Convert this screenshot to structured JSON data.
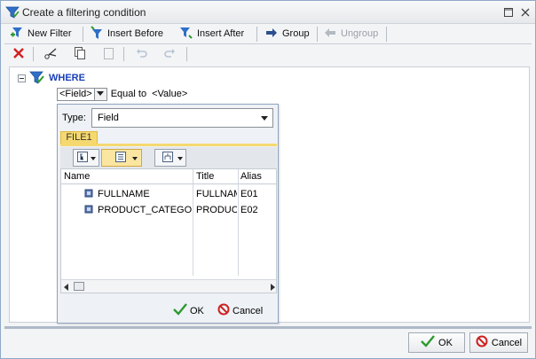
{
  "window": {
    "title": "Create a filtering condition"
  },
  "toolbar": {
    "new_filter": "New Filter",
    "insert_before": "Insert Before",
    "insert_after": "Insert After",
    "group": "Group",
    "ungroup": "Ungroup"
  },
  "condition": {
    "where_label": "WHERE",
    "field": "<Field>",
    "operator": "Equal to",
    "value": "<Value>"
  },
  "popup": {
    "type_label": "Type:",
    "type_value": "Field",
    "file_tab": "FILE1",
    "columns": [
      "Name",
      "Title",
      "Alias"
    ],
    "rows": [
      {
        "name": "FULLNAME",
        "title": "FULLNAM",
        "alias": "E01"
      },
      {
        "name": "PRODUCT_CATEGORY",
        "title": "PRODUCT",
        "alias": "E02"
      }
    ],
    "ok": "OK",
    "cancel": "Cancel"
  },
  "dialog": {
    "ok": "OK",
    "cancel": "Cancel"
  },
  "colors": {
    "accent": "#1a3fb8",
    "tab": "#f5d970",
    "ok_green": "#2e9a2e",
    "cancel_red": "#cc2222"
  }
}
